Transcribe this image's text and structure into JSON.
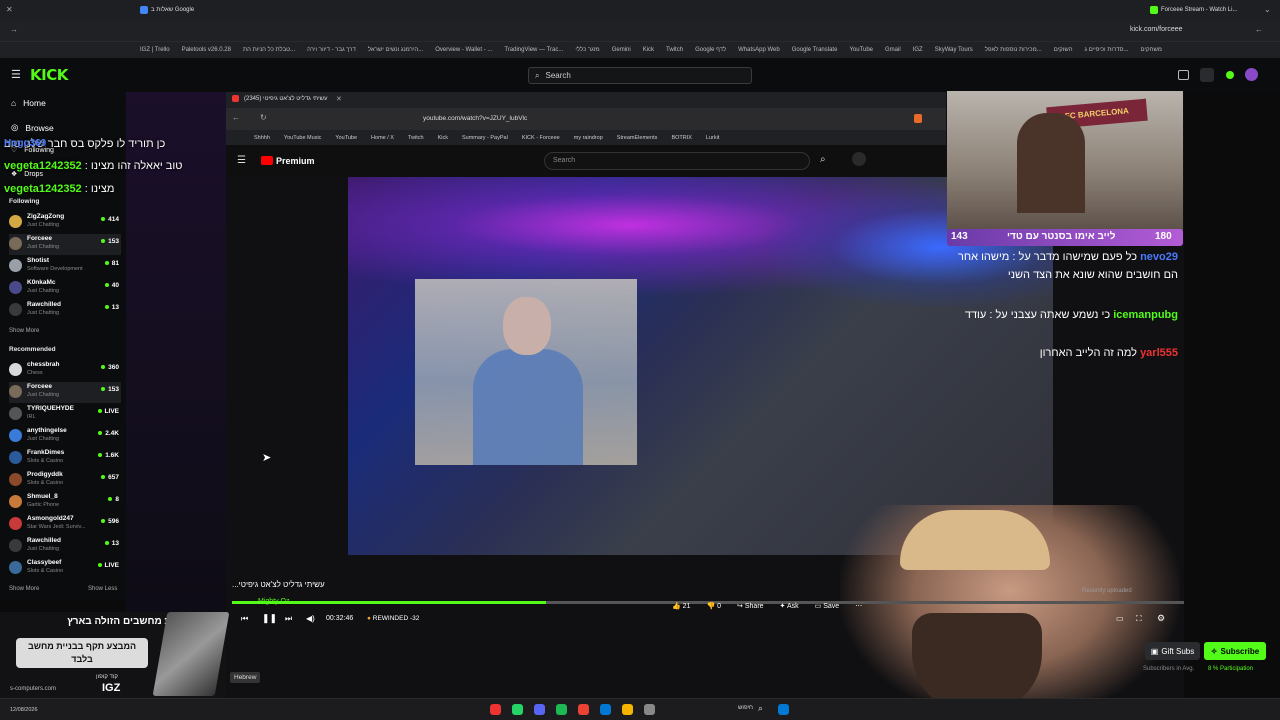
{
  "browser": {
    "tabs": [
      {
        "label": "שאלות ב Google"
      },
      {
        "label": "Forceee Stream - Watch Li..."
      }
    ],
    "url": "kick.com/forceee",
    "bookmarks": [
      "IGZ | Trello",
      "Paletools v26.0.28",
      "טבלת כל הניות הת...",
      "דרך גבר - דיוור וירה",
      "הירמנג ונשים ישראל...",
      "Overview - Wallet - ...",
      "TradingView — Trac...",
      "מזגר כללי",
      "Gemini",
      "Kick",
      "Twitch",
      "Google לדף",
      "WhatsApp Web",
      "Google Translate",
      "YouTube",
      "Gmail",
      "IGZ",
      "SkyWay Tours",
      "מכירות נוספות לאפל...",
      "השוקים",
      "סדרות וכיפיים ג...",
      "משחקים"
    ]
  },
  "kick": {
    "logo": "KICK",
    "search_placeholder": "Search",
    "nav": [
      {
        "label": "Home",
        "icon": "home-icon"
      },
      {
        "label": "Browse",
        "icon": "compass-icon"
      },
      {
        "label": "Following",
        "icon": "heart-icon"
      },
      {
        "label": "Drops",
        "icon": "gift-icon"
      }
    ],
    "following_title": "Following",
    "following": [
      {
        "name": "ZigZagZong",
        "category": "Just Chatting",
        "viewers": "414",
        "color": "#d4a843"
      },
      {
        "name": "Forceee",
        "category": "Just Chatting",
        "viewers": "153",
        "color": "#7a6a5a"
      },
      {
        "name": "Shotist",
        "category": "Software Development",
        "viewers": "81",
        "color": "#9aa0a8"
      },
      {
        "name": "K0nkaMc",
        "category": "Just Chatting",
        "viewers": "40",
        "color": "#4a4a8a"
      },
      {
        "name": "Rawchilled",
        "category": "Just Chatting",
        "viewers": "13",
        "color": "#3a3a3a"
      }
    ],
    "show_more": "Show More",
    "recommended_title": "Recommended",
    "recommended": [
      {
        "name": "chessbrah",
        "category": "Chess",
        "viewers": "360",
        "color": "#d8d8d8"
      },
      {
        "name": "Forceee",
        "category": "Just Chatting",
        "viewers": "153",
        "color": "#7a6a5a"
      },
      {
        "name": "TYRIQUEHYDE",
        "category": "IRL",
        "viewers": "LIVE",
        "color": "#555"
      },
      {
        "name": "anythingelse",
        "category": "Just Chatting",
        "viewers": "2.4K",
        "color": "#3a7ad8"
      },
      {
        "name": "FrankDimes",
        "category": "Slots & Casino",
        "viewers": "1.6K",
        "color": "#2a5a9a"
      },
      {
        "name": "Prodigyddk",
        "category": "Slots & Casino",
        "viewers": "657",
        "color": "#8a4a2a"
      },
      {
        "name": "Shmuel_8",
        "category": "Gartic Phone",
        "viewers": "8",
        "color": "#c87a3a"
      },
      {
        "name": "Asmongold247",
        "category": "Star Wars Jedi: Surviv...",
        "viewers": "596",
        "color": "#c83a3a"
      },
      {
        "name": "Rawchilled",
        "category": "Just Chatting",
        "viewers": "13",
        "color": "#3a3a3a"
      },
      {
        "name": "Classybeef",
        "category": "Slots & Casino",
        "viewers": "LIVE",
        "color": "#3a6a9a"
      }
    ],
    "show_less": "Show Less"
  },
  "inner_browser": {
    "tab": "עשיתי גדליט לצ'אט גיפיטי (2345)",
    "url": "youtube.com/watch?v=JZUY_lubVlc",
    "bookmarks": [
      "Shhhh",
      "YouTube Music",
      "YouTube",
      "Home / X",
      "Twitch",
      "Kick",
      "Summary - PayPal",
      "KICK - Forceee",
      "my raindrop",
      "StreamElements",
      "BOTRIX",
      "Lurkit"
    ]
  },
  "youtube": {
    "logo": "Premium",
    "search_placeholder": "Search",
    "video_title": "עשיתי גדליט לצ'אט גיפיטי...",
    "channel": "Mighty Oz",
    "time": "00:32:46",
    "rewind_label": "REWINDED -32",
    "progress": 0.33,
    "likes": "21",
    "dislikes": "0",
    "share": "Share",
    "ask": "Ask",
    "save": "Save",
    "recently_uploaded": "Recently uploaded"
  },
  "overlay_chat": [
    {
      "user": "",
      "text": "כן תוריד לו פלקס בס חבר שלנו טוב"
    },
    {
      "user": "Hogo369",
      "text": ""
    },
    {
      "user": "vegeta1242352",
      "text": "טוב יאאלה זהו מצינו"
    },
    {
      "user": "vegeta1242352",
      "text": "מצינו"
    }
  ],
  "side_chat": [
    {
      "user": "nevo29",
      "text": "כל פעם שמישהו מדבר על : מישהו אחר הם חושבים שהוא שונא את הצד השני"
    },
    {
      "user": "icemanpubg",
      "text": "כי נשמע שאתה עצבני על : עודד"
    },
    {
      "user": "yarl555",
      "text": "למה זה הלייב האחרון"
    }
  ],
  "sub_banner": {
    "count_left": "143",
    "text": "לייב אימו בסנטר עם טדי",
    "count_right": "180"
  },
  "cam_flag": "FC BARCELONA",
  "buttons": {
    "gift_subs": "Gift Subs",
    "subscribe": "Subscribe",
    "avg": "Subscribers in Avg.",
    "participation": "8 % Participation"
  },
  "promo": {
    "headline": "חנות מחשבים הזולה בארץ",
    "sub": "המבצע תקף בבניית מחשב בלבד",
    "code_label": "קוד קופון",
    "code": "IGZ",
    "site": "s-computers.com"
  },
  "taskbar": {
    "search": "חיפוש",
    "lang": "Hebrew",
    "time": "12/08/2026"
  },
  "colors": {
    "kick_green": "#53fc18",
    "banner_purple": "#8a48c0"
  }
}
